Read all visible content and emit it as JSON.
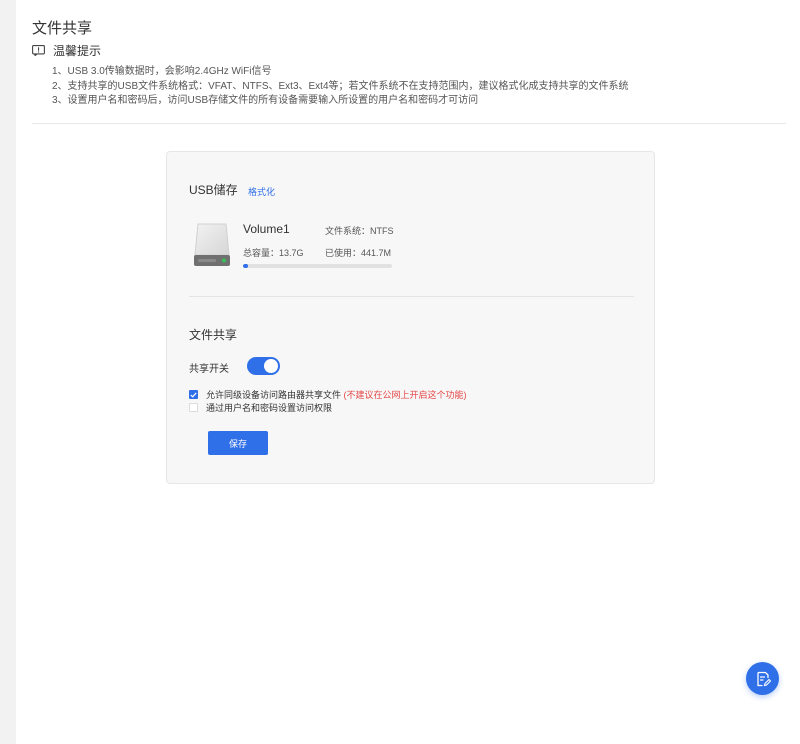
{
  "page": {
    "title": "文件共享"
  },
  "tips": {
    "heading": "温馨提示",
    "items": [
      "1、USB 3.0传输数据时，会影响2.4GHz WiFi信号",
      "2、支持共享的USB文件系统格式：VFAT、NTFS、Ext3、Ext4等；若文件系统不在支持范围内，建议格式化成支持共享的文件系统",
      "3、设置用户名和密码后，访问USB存储文件的所有设备需要输入所设置的用户名和密码才可访问"
    ]
  },
  "usb": {
    "title": "USB储存",
    "format_link": "格式化",
    "volume": {
      "name": "Volume1",
      "filesystem": "文件系统：NTFS",
      "total": "总容量：13.7G",
      "used": "已使用：441.7M",
      "used_fraction": 0.032
    }
  },
  "share": {
    "title": "文件共享",
    "switch_label": "共享开关",
    "switch_on": true,
    "option1_label": "允许同级设备访问路由器共享文件",
    "option1_warning": "(不建议在公网上开启这个功能)",
    "option1_checked": true,
    "option2_label": "通过用户名和密码设置访问权限",
    "option2_checked": false,
    "save_label": "保存"
  },
  "colors": {
    "accent": "#2f6fe8",
    "warning": "#e64545",
    "led": "#35c05a"
  },
  "icons": {
    "tips": "notice-icon",
    "drive": "hard-drive-icon",
    "fab": "feedback-edit-icon"
  }
}
